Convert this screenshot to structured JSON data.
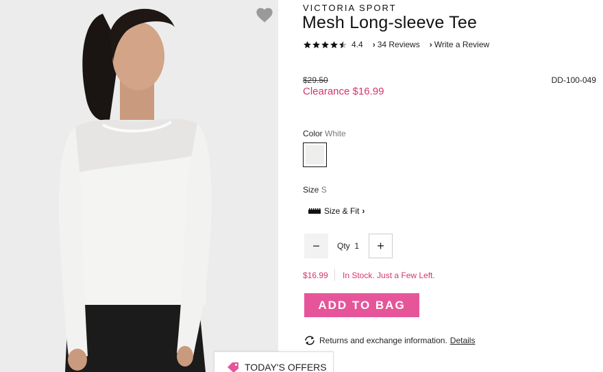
{
  "product": {
    "brand": "VICTORIA SPORT",
    "title": "Mesh Long-sleeve Tee",
    "rating_value": "4.4",
    "rating_stars": 4.4,
    "reviews_link": "34 Reviews",
    "write_review_link": "Write a Review",
    "original_price": "$29.50",
    "clearance_price": "Clearance $16.99",
    "sku": "DD-100-049"
  },
  "options": {
    "color_label": "Color",
    "color_value": "White",
    "size_label": "Size",
    "size_value": "S",
    "size_fit_link": "Size & Fit"
  },
  "quantity": {
    "label": "Qty",
    "value": "1",
    "minus_symbol": "−",
    "plus_symbol": "+"
  },
  "availability": {
    "price": "$16.99",
    "stock_text": "In Stock. Just a Few Left."
  },
  "actions": {
    "add_to_bag": "ADD TO BAG",
    "returns_text": "Returns and exchange information.",
    "details_link": "Details"
  },
  "footer": {
    "offers_label": "TODAY'S OFFERS"
  },
  "icons": {
    "favorite": "heart-icon",
    "star": "star-icon",
    "chevron": "chevron-right-icon",
    "ruler": "ruler-icon",
    "returns": "refresh-arrows-icon",
    "offers": "tag-icon"
  },
  "colors": {
    "accent_pink": "#d6336c",
    "button_pink": "#e6559a",
    "image_bg": "#ececec"
  }
}
